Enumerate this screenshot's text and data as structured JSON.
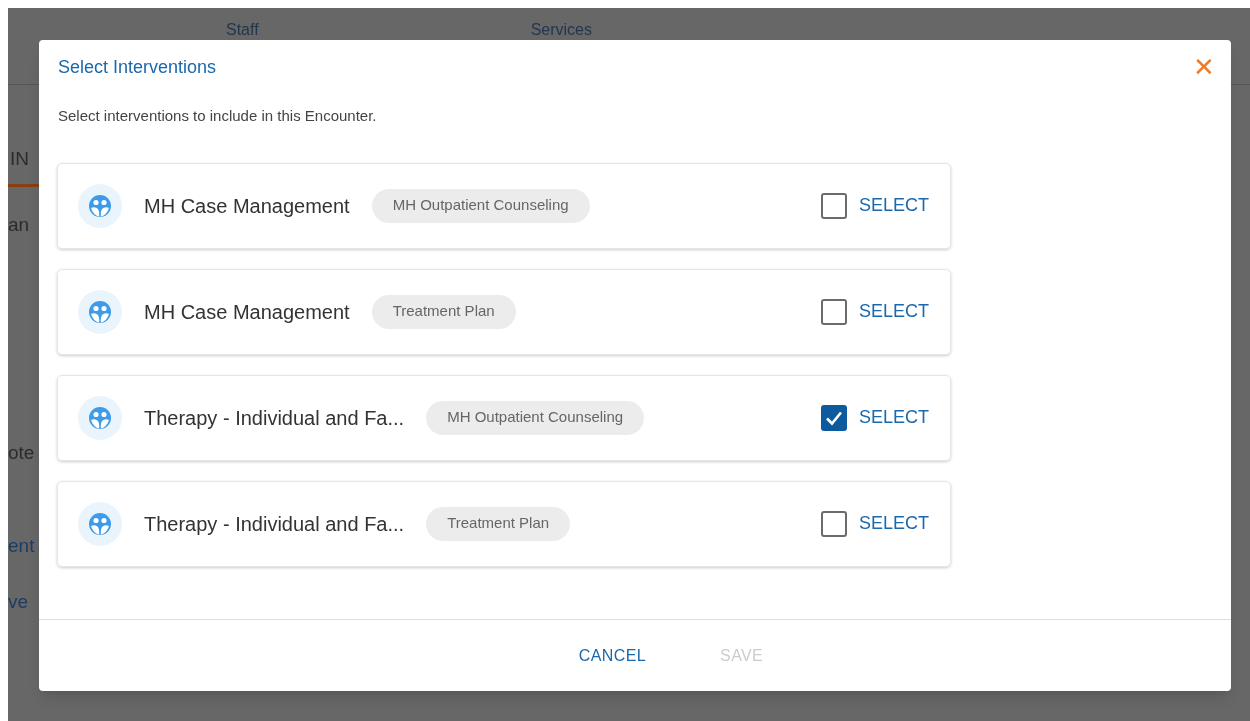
{
  "background": {
    "header_columns": [
      "Staff",
      "Services"
    ],
    "tab": "IN",
    "texts": [
      {
        "text": "an",
        "kind": "plain"
      },
      {
        "text": "ote",
        "kind": "plain"
      },
      {
        "text": "ent",
        "kind": "link"
      },
      {
        "text": "ve",
        "kind": "link"
      }
    ]
  },
  "dialog": {
    "title": "Select Interventions",
    "close": "✕",
    "description": "Select interventions to include in this Encounter.",
    "items": [
      {
        "name": "MH Case Management",
        "tag": "MH Outpatient Counseling",
        "action": "SELECT",
        "checked": false
      },
      {
        "name": "MH Case Management",
        "tag": "Treatment Plan",
        "action": "SELECT",
        "checked": false
      },
      {
        "name": "Therapy - Individual and Fa...",
        "tag": "MH Outpatient Counseling",
        "action": "SELECT",
        "checked": true
      },
      {
        "name": "Therapy - Individual and Fa...",
        "tag": "Treatment Plan",
        "action": "SELECT",
        "checked": false
      }
    ],
    "buttons": [
      {
        "label": "CANCEL",
        "disabled": false
      },
      {
        "label": "SAVE",
        "disabled": true
      }
    ]
  }
}
